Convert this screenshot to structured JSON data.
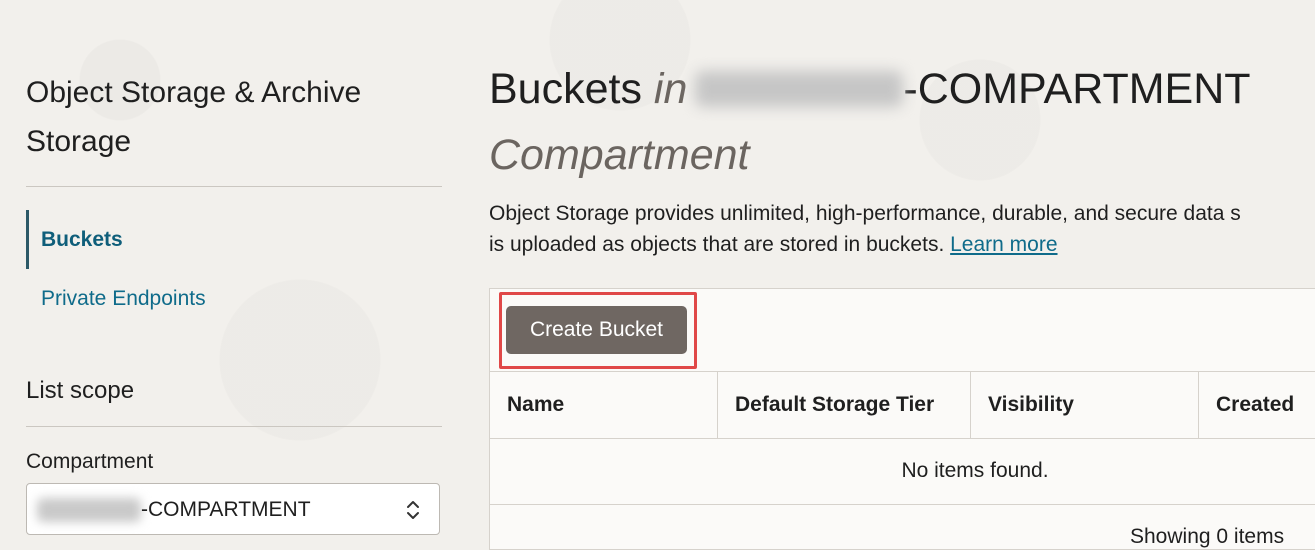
{
  "sidebar": {
    "title": "Object Storage & Archive Storage",
    "nav": [
      {
        "label": "Buckets",
        "active": true
      },
      {
        "label": "Private Endpoints",
        "active": false
      }
    ],
    "scope_title": "List scope",
    "compartment_label": "Compartment",
    "compartment_value": "-COMPARTMENT"
  },
  "main": {
    "title_prefix": "Buckets",
    "title_in": "in",
    "title_suffix": "-COMPARTMENT",
    "subtitle": "Compartment",
    "description_line1": "Object Storage provides unlimited, high-performance, durable, and secure data s",
    "description_line2": "is uploaded as objects that are stored in buckets.",
    "learn_more": "Learn more",
    "create_button": "Create Bucket",
    "table": {
      "columns": [
        "Name",
        "Default Storage Tier",
        "Visibility",
        "Created"
      ],
      "empty_message": "No items found.",
      "footer": "Showing 0 items"
    }
  },
  "colors": {
    "link": "#0f6b8a",
    "button_bg": "#6f6762",
    "highlight": "#e04848",
    "page_bg": "#f2f0ec"
  }
}
